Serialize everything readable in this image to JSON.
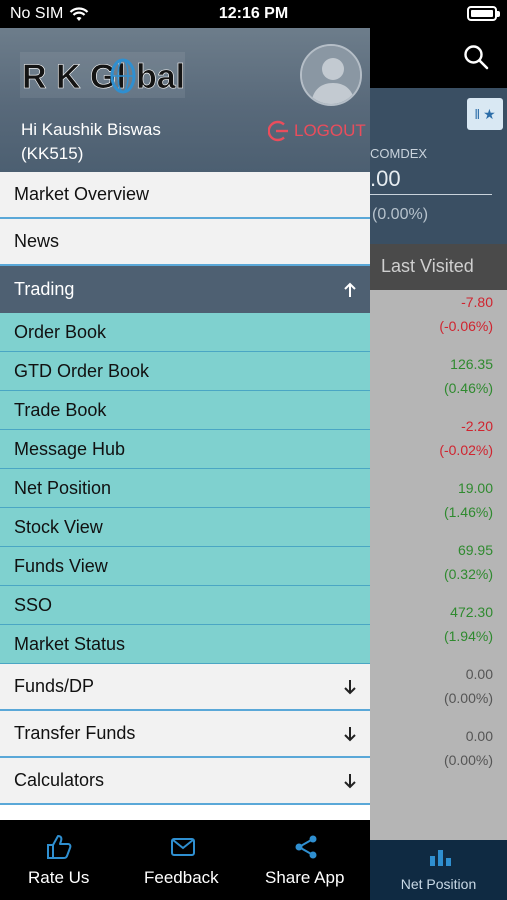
{
  "status": {
    "carrier": "No SIM",
    "time": "12:16 PM"
  },
  "background": {
    "comdex_label": "COMDEX",
    "comdex_value": ".00",
    "comdex_change": "(0.00%)",
    "tab_label": "Last Visited",
    "rows": [
      {
        "change": "-7.80",
        "pct": "(-0.06%)",
        "color": "#d0242f"
      },
      {
        "change": "126.35",
        "pct": "(0.46%)",
        "color": "#2f8a2f"
      },
      {
        "change": "-2.20",
        "pct": "(-0.02%)",
        "color": "#d0242f"
      },
      {
        "change": "19.00",
        "pct": "(1.46%)",
        "color": "#2f8a2f"
      },
      {
        "change": "69.95",
        "pct": "(0.32%)",
        "color": "#2f8a2f"
      },
      {
        "change": "472.30",
        "pct": "(1.94%)",
        "color": "#2f8a2f"
      },
      {
        "change": "0.00",
        "pct": "(0.00%)",
        "color": "#555555"
      },
      {
        "change": "0.00",
        "pct": "(0.00%)",
        "color": "#555555"
      }
    ],
    "bottom_label": "Net Position"
  },
  "drawer": {
    "logo_text": "R K Global",
    "greeting_line1": "Hi Kaushik Biswas",
    "greeting_line2": "(KK515)",
    "logout_label": "LOGOUT",
    "menu": {
      "market_overview": "Market Overview",
      "news": "News",
      "trading": "Trading",
      "trading_sub": [
        "Order Book",
        "GTD Order Book",
        "Trade Book",
        "Message Hub",
        "Net Position",
        "Stock View",
        "Funds View",
        "SSO",
        "Market Status"
      ],
      "funds_dp": "Funds/DP",
      "transfer_funds": "Transfer Funds",
      "calculators": "Calculators"
    }
  },
  "bottom_bar": {
    "rate_us": "Rate Us",
    "feedback": "Feedback",
    "share_app": "Share App"
  },
  "colors": {
    "accent_blue": "#2f8fd0",
    "logout_red": "#ea4d5c",
    "submenu_teal": "#7fd1cf",
    "section_slate": "#4e6072"
  },
  "icons": [
    "wifi-icon",
    "battery-icon",
    "search-icon",
    "star-icon",
    "avatar-icon",
    "logout-icon",
    "chevron-up-icon",
    "chevron-down-icon",
    "thumbs-up-icon",
    "mail-icon",
    "share-icon",
    "bar-chart-icon"
  ]
}
